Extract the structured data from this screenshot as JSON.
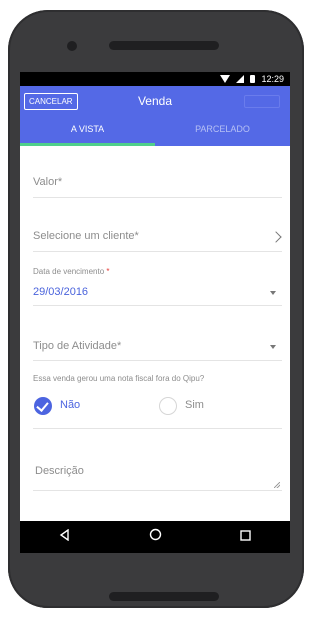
{
  "status_bar": {
    "time": "12:29"
  },
  "app_bar": {
    "cancel_label": "CANCELAR",
    "title": "Venda"
  },
  "tabs": [
    {
      "label": "A VISTA",
      "active": true
    },
    {
      "label": "PARCELADO",
      "active": false
    }
  ],
  "form": {
    "valor_placeholder": "Valor*",
    "cliente_placeholder": "Selecione um cliente*",
    "vencimento_label": "Data de vencimento",
    "required_mark": "*",
    "vencimento_value": "29/03/2016",
    "atividade_placeholder": "Tipo de Atividade*",
    "nota_question": "Essa venda gerou uma nota fiscal fora do Qipu?",
    "nota_options": [
      {
        "label": "Não",
        "selected": true
      },
      {
        "label": "Sim",
        "selected": false
      }
    ],
    "descricao_placeholder": "Descrição"
  },
  "colors": {
    "primary": "#5469e6",
    "tab_indicator": "#4fcf8a",
    "accent": "#4c64e0",
    "required": "#e53935"
  },
  "icons": {
    "status": [
      "wifi-icon",
      "signal-icon",
      "battery-icon"
    ],
    "nav": [
      "back-icon",
      "home-icon",
      "recent-apps-icon"
    ]
  }
}
